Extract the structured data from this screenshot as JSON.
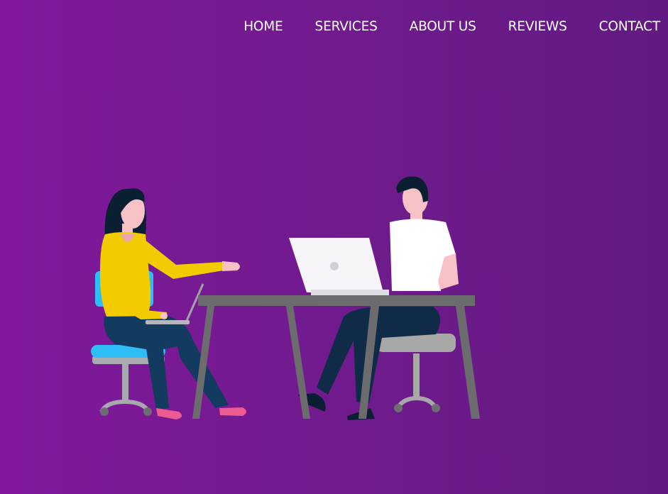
{
  "navbar": {
    "links": [
      {
        "label": "HOME"
      },
      {
        "label": "SERVICES"
      },
      {
        "label": "ABOUT US"
      },
      {
        "label": "REVIEWS"
      },
      {
        "label": "CONTACT"
      }
    ]
  },
  "hero": {
    "illustration": "two-people-working-at-desk-illustration"
  },
  "colors": {
    "background_left": "#82189c",
    "background_right": "#621a82",
    "nav_text": "#ffffff",
    "woman_shirt": "#f3cc00",
    "chair_seat": "#2ebdf5",
    "pants": "#133a5f",
    "table": "#6c6c6f",
    "laptop": "#f6f4f8",
    "man_chair": "#a8a8a8"
  }
}
